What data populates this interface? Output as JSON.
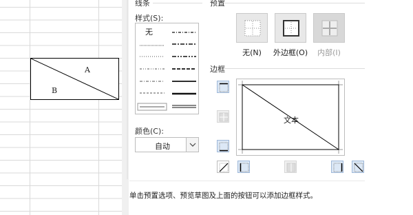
{
  "sheet": {
    "cell_text_a": "A",
    "cell_text_b": "B"
  },
  "line_group": {
    "title": "线条",
    "style_label": "样式(S):",
    "none_style": "无",
    "color_label": "颜色(C):",
    "color_value": "自动"
  },
  "presets_group": {
    "title": "预置",
    "items": [
      {
        "label": "无(N)",
        "icon": "border-none-icon",
        "enabled": true
      },
      {
        "label": "外边框(O)",
        "icon": "border-outline-icon",
        "enabled": true
      },
      {
        "label": "内部(I)",
        "icon": "border-inside-icon",
        "enabled": false
      }
    ]
  },
  "border_group": {
    "title": "边框",
    "preview_text": "文本",
    "buttons": [
      {
        "name": "border-top-button",
        "icon": "border-top-icon",
        "enabled": true
      },
      {
        "name": "border-inside-horizontal-button",
        "icon": "border-inside-horizontal-icon",
        "enabled": false
      },
      {
        "name": "border-bottom-button",
        "icon": "border-bottom-icon",
        "enabled": true
      },
      {
        "name": "border-diagonal-up-button",
        "icon": "diagonal-up-icon",
        "enabled": true
      },
      {
        "name": "border-left-button",
        "icon": "border-left-icon",
        "enabled": true
      },
      {
        "name": "border-inside-vertical-button",
        "icon": "border-inside-vertical-icon",
        "enabled": false
      },
      {
        "name": "border-right-button",
        "icon": "border-right-icon",
        "enabled": true
      },
      {
        "name": "border-diagonal-down-button",
        "icon": "diagonal-down-icon",
        "enabled": true
      }
    ]
  },
  "hint": "单击预置选项、预览草图及上面的按钮可以添加边框样式。",
  "colors": {
    "button_active_bg": "#dce8f6",
    "button_active_border": "#9fb8d8",
    "dialog_bg": "#ffffff"
  }
}
